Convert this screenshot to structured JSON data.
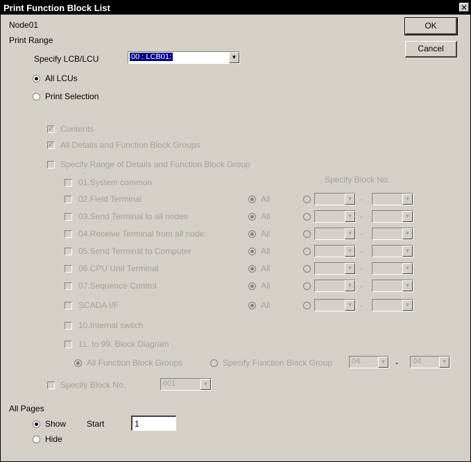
{
  "window": {
    "title": "Print Function Block List",
    "close_glyph": "✕"
  },
  "node_label": "Node01",
  "print_range": {
    "label": "Print Range",
    "specify_label": "Specify LCB/LCU",
    "specify_value": "00 : LCB01:",
    "all_lcus": "All LCUs",
    "print_selection": "Print Selection",
    "contents": "Contents",
    "all_details": "All Details and Function Block Groups",
    "specify_range": "Specify Range of Details and Function Block Group",
    "specify_block_no_header": "Specify Block No.",
    "dash": "-",
    "all_label": "All",
    "rows": [
      {
        "label": "01.System common"
      },
      {
        "label": "02.Field Terminal"
      },
      {
        "label": "03.Send Terminal to all nodes"
      },
      {
        "label": "04.Receive Terminal from all node:"
      },
      {
        "label": "05.Send Terminal to Computer"
      },
      {
        "label": "06.CPU Unit Terminal"
      },
      {
        "label": "07.Sequence Control"
      },
      {
        "label": "SCADA I/F"
      },
      {
        "label": "10.Internal switch"
      },
      {
        "label": "11. to 99. Block Diagram"
      }
    ],
    "all_fb_groups": "All Function Block Groups",
    "specify_fb_group": "Specify Function Block Group",
    "fb_group_from": "04",
    "fb_group_to": "04",
    "specify_block_no": "Specify Block No.",
    "block_no_value": "001"
  },
  "all_pages": {
    "label": "All Pages",
    "show": "Show",
    "start_label": "Start",
    "start_value": "1",
    "hide": "Hide"
  },
  "buttons": {
    "ok": "OK",
    "cancel": "Cancel"
  }
}
